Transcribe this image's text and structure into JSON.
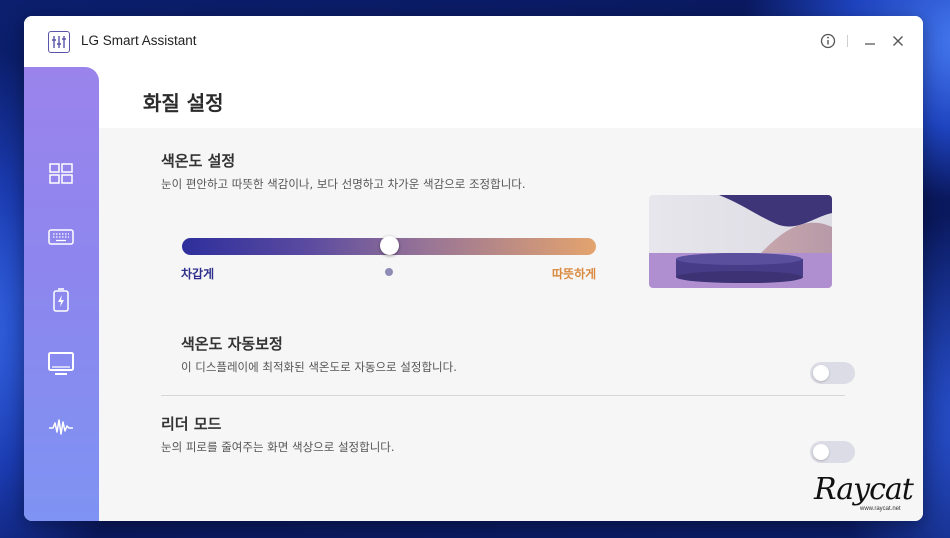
{
  "window": {
    "app_title": "LG Smart Assistant"
  },
  "titlebar": {
    "icons": [
      "info-icon",
      "minimize-icon",
      "close-icon"
    ]
  },
  "sidebar": {
    "items": [
      {
        "icon": "layout-grid-icon"
      },
      {
        "icon": "keyboard-icon"
      },
      {
        "icon": "battery-charging-icon"
      },
      {
        "icon": "monitor-icon",
        "active": true
      },
      {
        "icon": "audio-wave-icon"
      }
    ]
  },
  "page": {
    "title": "화질 설정"
  },
  "color_temp": {
    "title": "색온도 설정",
    "description": "눈이 편안하고 따뜻한 색감이나, 보다 선명하고 차가운 색감으로 조정합니다.",
    "cool_label": "차갑게",
    "warm_label": "따뜻하게",
    "slider_value": 0.5
  },
  "auto_correct": {
    "title": "색온도 자동보정",
    "description": "이 디스플레이에 최적화된 색온도로 자동으로 설정합니다.",
    "enabled": false
  },
  "reader_mode": {
    "title": "리더 모드",
    "description": "눈의 피로를 줄여주는 화면 색상으로 설정합니다.",
    "enabled": false
  },
  "watermark": {
    "logo_text": "Raycat",
    "url": "www.raycat.net"
  },
  "colors": {
    "accent": "#8d86ee",
    "cool": "#2e2f8c",
    "warm": "#d98a3f"
  }
}
